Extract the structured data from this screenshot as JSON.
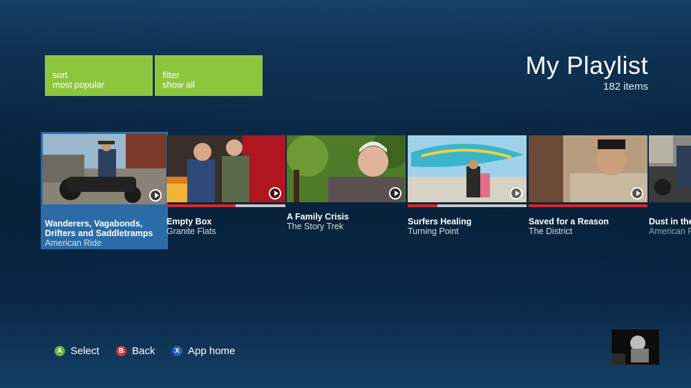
{
  "header": {
    "title": "My Playlist",
    "count": "182 items"
  },
  "controls": {
    "sort": {
      "label": "sort",
      "value": "most popular"
    },
    "filter": {
      "label": "filter",
      "value": "show all"
    }
  },
  "items": [
    {
      "title": "Wanderers, Vagabonds, Drifters and Saddletramps",
      "subtitle": "American Ride",
      "selected": true,
      "progress": null
    },
    {
      "title": "Empty Box",
      "subtitle": "Granite Flats",
      "progress": 0.58
    },
    {
      "title": "A Family Crisis",
      "subtitle": "The Story Trek",
      "progress": null
    },
    {
      "title": "Surfers Healing",
      "subtitle": "Turning Point",
      "progress": 0.25
    },
    {
      "title": "Saved for a Reason",
      "subtitle": "The District",
      "progress": 1.0
    },
    {
      "title": "Dust in the",
      "subtitle": "American R",
      "progress": null
    }
  ],
  "legend": [
    {
      "key": "A",
      "label": "Select",
      "color": "#6cb33f"
    },
    {
      "key": "B",
      "label": "Back",
      "color": "#d33b3b"
    },
    {
      "key": "X",
      "label": "App home",
      "color": "#2a5fb0"
    }
  ],
  "colors": {
    "accent": "#8cc63f",
    "selection": "#2b6ca8",
    "progress": "#d8282f"
  },
  "icons": {
    "play": "play-circle-icon"
  }
}
